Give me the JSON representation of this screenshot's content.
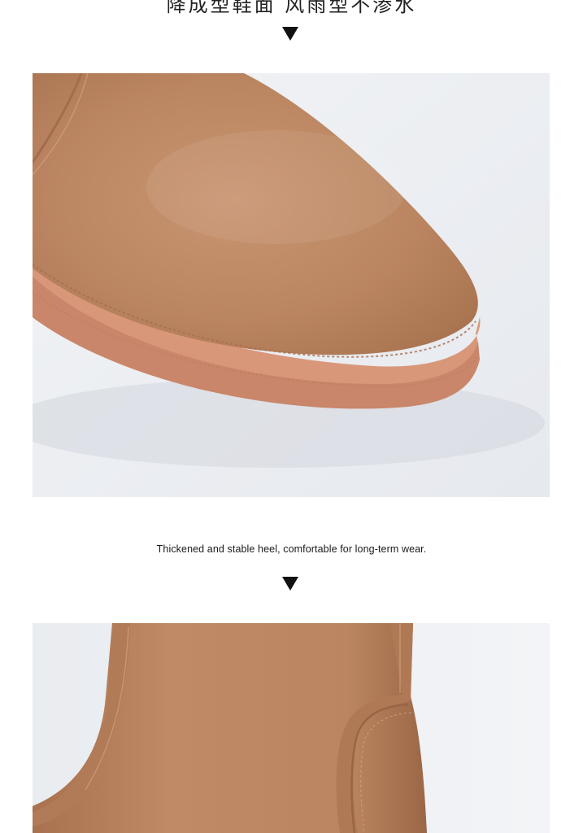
{
  "captions": {
    "top": "降成型鞋面 风雨型不渗水",
    "middle": "Thickened and stable heel, comfortable for long-term wear."
  },
  "colors": {
    "boot": "#c08a66",
    "sole": "#d9977a",
    "background": "#ffffff"
  },
  "icons": {
    "divider_arrow": "down-triangle-icon"
  }
}
